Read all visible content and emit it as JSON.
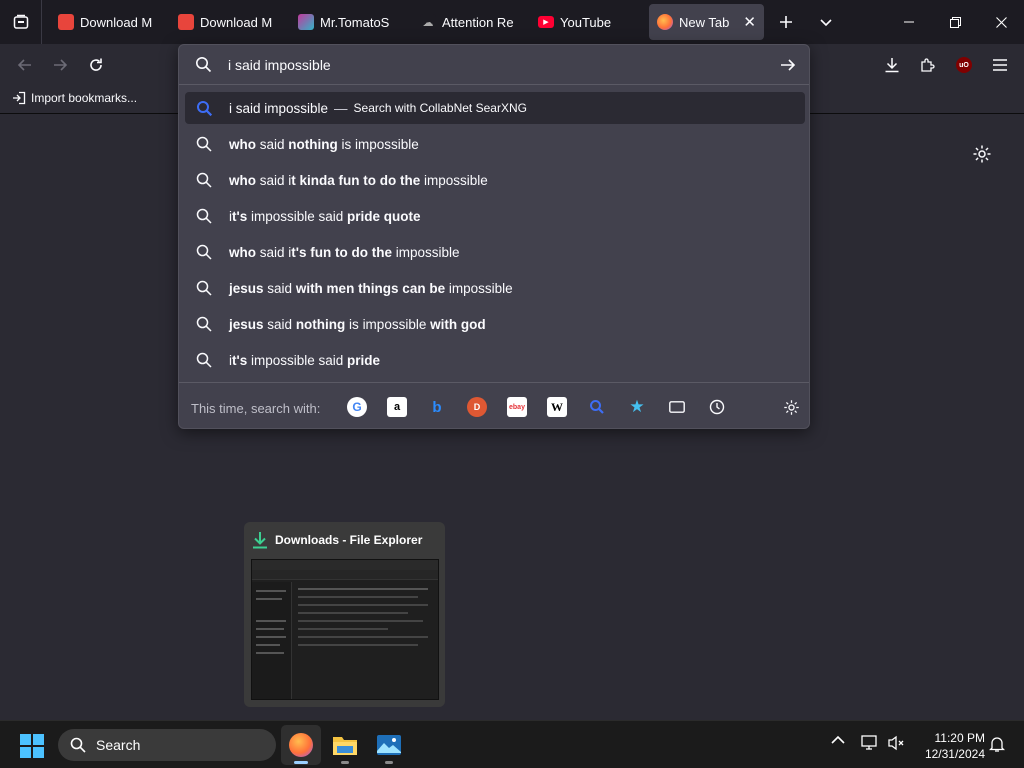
{
  "tabs": [
    {
      "title": "Download Mr.",
      "color": "#e8453c"
    },
    {
      "title": "Download Ms",
      "color": "#e8453c"
    },
    {
      "title": "Mr.TomatoS b",
      "color": "#c2399c"
    },
    {
      "title": "Attention Req",
      "color": "#6b6b6b"
    },
    {
      "title": "YouTube",
      "color": "#ff0033"
    },
    {
      "title": "New Tab",
      "color": "#ff7139"
    }
  ],
  "bookmarks": {
    "import_label": "Import bookmarks..."
  },
  "urlbar": {
    "value": "i said impossible",
    "first_result": {
      "query": "i said impossible",
      "action": "Search with CollabNet SearXNG"
    },
    "suggestions": [
      [
        {
          "t": "who",
          "b": true
        },
        {
          "t": " said ",
          "b": false
        },
        {
          "t": "nothing",
          "b": true
        },
        {
          "t": " is ",
          "b": false
        },
        {
          "t": "impossible",
          "b": false
        }
      ],
      [
        {
          "t": "who",
          "b": true
        },
        {
          "t": " said i",
          "b": false
        },
        {
          "t": "t kinda fun to do the",
          "b": true
        },
        {
          "t": " impossible",
          "b": false
        }
      ],
      [
        {
          "t": "i",
          "b": false
        },
        {
          "t": "t's",
          "b": true
        },
        {
          "t": " impossible said ",
          "b": false
        },
        {
          "t": "pride quote",
          "b": true
        }
      ],
      [
        {
          "t": "who",
          "b": true
        },
        {
          "t": " said i",
          "b": false
        },
        {
          "t": "t's fun to do the",
          "b": true
        },
        {
          "t": " impossible",
          "b": false
        }
      ],
      [
        {
          "t": "jesus",
          "b": true
        },
        {
          "t": " said ",
          "b": false
        },
        {
          "t": "with men things can be",
          "b": true
        },
        {
          "t": " impossible",
          "b": false
        }
      ],
      [
        {
          "t": "jesus",
          "b": true
        },
        {
          "t": " said ",
          "b": false
        },
        {
          "t": "nothing",
          "b": true
        },
        {
          "t": " is ",
          "b": false
        },
        {
          "t": "impossible",
          "b": false
        },
        {
          "t": " with god",
          "b": true
        }
      ],
      [
        {
          "t": "i",
          "b": false
        },
        {
          "t": "t's",
          "b": true
        },
        {
          "t": " impossible said ",
          "b": false
        },
        {
          "t": "pride",
          "b": true
        }
      ]
    ],
    "engines_label": "This time, search with:",
    "engines": [
      "google",
      "amazon",
      "bing",
      "duckduckgo",
      "ebay",
      "wikipedia",
      "searxng",
      "bookmarks",
      "tabs",
      "history"
    ]
  },
  "thumbnail": {
    "title": "Downloads - File Explorer"
  },
  "taskbar": {
    "search_label": "Search",
    "time": "11:20 PM",
    "date": "12/31/2024"
  }
}
